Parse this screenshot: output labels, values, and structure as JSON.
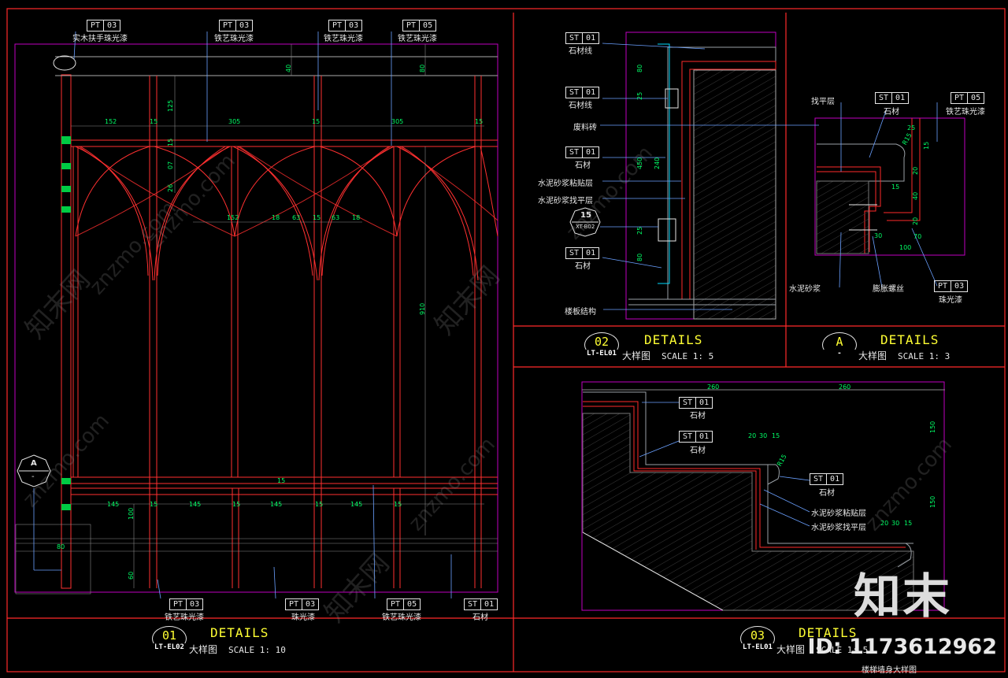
{
  "drawing": {
    "watermark_text": "znzmo.com",
    "watermark_cn": "知末网",
    "logo": "知末",
    "id_text": "ID: 1173612962",
    "colors": {
      "background": "#000000",
      "frame": "#ff2a2a",
      "viewport": "#c000c0",
      "text": "#e6e6e6",
      "dimension": "#00ff66",
      "title": "#ffff33"
    }
  },
  "panel01": {
    "title_num": "01",
    "title_ref": "LT-EL02",
    "title_word": "DETAILS",
    "title_name": "大样图",
    "title_scale": "SCALE  1: 10",
    "tags_top": [
      {
        "code": "PT",
        "num": "03",
        "label": "实木扶手珠光漆"
      },
      {
        "code": "PT",
        "num": "03",
        "label": "铁艺珠光漆"
      },
      {
        "code": "PT",
        "num": "03",
        "label": "铁艺珠光漆"
      },
      {
        "code": "PT",
        "num": "05",
        "label": "铁艺珠光漆"
      }
    ],
    "tags_bottom": [
      {
        "code": "PT",
        "num": "03",
        "label": "铁艺珠光漆"
      },
      {
        "code": "PT",
        "num": "03",
        "label": "珠光漆"
      },
      {
        "code": "PT",
        "num": "05",
        "label": "铁艺珠光漆"
      },
      {
        "code": "ST",
        "num": "01",
        "label": "石材"
      }
    ],
    "section_marker": {
      "letter": "A",
      "ref": "-"
    },
    "dims_top": [
      "152",
      "15",
      "305",
      "15",
      "305",
      "15"
    ],
    "dims_mid": [
      "152",
      "18",
      "63",
      "15",
      "63",
      "18"
    ],
    "dims_bottom": [
      "145",
      "15",
      "145",
      "15",
      "145",
      "15",
      "145",
      "15"
    ],
    "dims_vertical": [
      "40",
      "80",
      "125",
      "15",
      "07",
      "26",
      "910",
      "100",
      "60",
      "80",
      "15"
    ]
  },
  "panel02": {
    "title_num": "02",
    "title_ref": "LT-EL01",
    "title_word": "DETAILS",
    "title_name": "大样图",
    "title_scale": "SCALE  1: 5",
    "labels": [
      {
        "code": "ST",
        "num": "01",
        "label": "石材线"
      },
      {
        "code": "ST",
        "num": "01",
        "label": "石材线"
      },
      {
        "label": "废料砖"
      },
      {
        "code": "ST",
        "num": "01",
        "label": "石材"
      },
      {
        "label": "水泥砂浆粘贴层"
      },
      {
        "label": "水泥砂浆找平层"
      },
      {
        "code": "ST",
        "num": "01",
        "label": "石材"
      },
      {
        "label": "楼板结构"
      }
    ],
    "callout": {
      "num": "15",
      "ref": "XT-B02"
    },
    "dims": [
      "80",
      "25",
      "450",
      "240",
      "25",
      "80"
    ]
  },
  "panelA": {
    "title_num": "A",
    "title_ref": "-",
    "title_word": "DETAILS",
    "title_name": "大样图",
    "title_scale": "SCALE  1: 3",
    "labels_top": [
      {
        "label": "找平层"
      },
      {
        "code": "ST",
        "num": "01",
        "label": "石材"
      },
      {
        "code": "PT",
        "num": "05",
        "label": "铁艺珠光漆"
      }
    ],
    "labels_bottom": [
      {
        "label": "水泥砂浆"
      },
      {
        "label": "膨胀螺丝"
      },
      {
        "code": "PT",
        "num": "03",
        "label": "珠光漆"
      }
    ],
    "dims": [
      "25",
      "15",
      "20",
      "15",
      "40",
      "20",
      "30",
      "70",
      "100",
      "R15"
    ]
  },
  "panel03": {
    "title_num": "03",
    "title_ref": "LT-EL01",
    "title_word": "DETAILS",
    "title_name": "大样图",
    "title_scale": "SCALE  1: 5",
    "subtitle": "楼梯墙身大样图",
    "labels": [
      {
        "code": "ST",
        "num": "01",
        "label": "石材"
      },
      {
        "code": "ST",
        "num": "01",
        "label": "石材"
      },
      {
        "code": "ST",
        "num": "01",
        "label": "石材"
      },
      {
        "label": "水泥砂浆粘贴层"
      },
      {
        "label": "水泥砂浆找平层"
      }
    ],
    "dims": [
      "260",
      "260",
      "150",
      "150",
      "20",
      "30",
      "15",
      "20",
      "30",
      "15",
      "R15"
    ]
  }
}
